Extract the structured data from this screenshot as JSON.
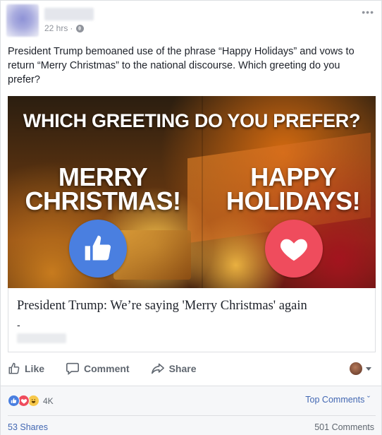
{
  "post": {
    "time": "22 hrs",
    "separator": "·",
    "more_label": "•••",
    "text": "President Trump bemoaned use of the phrase “Happy Holidays” and vows to return “Merry Christmas” to the national discourse. Which greeting do you prefer?"
  },
  "media": {
    "headline": "WHICH GREETING DO YOU PREFER?",
    "left_line1": "MERRY",
    "left_line2": "CHRISTMAS!",
    "right_line1": "HAPPY",
    "right_line2": "HOLIDAYS!"
  },
  "link": {
    "title": "President Trump: We’re saying 'Merry Christmas' again",
    "dash": "-"
  },
  "actions": {
    "like": "Like",
    "comment": "Comment",
    "share": "Share"
  },
  "footer": {
    "reactions_count": "4K",
    "top_comments": "Top Comments ˇ",
    "shares": "53 Shares",
    "comments": "501 Comments"
  },
  "colors": {
    "like_blue": "#4a7fe0",
    "love_red": "#ef4c5d",
    "link_blue": "#4267b2"
  }
}
